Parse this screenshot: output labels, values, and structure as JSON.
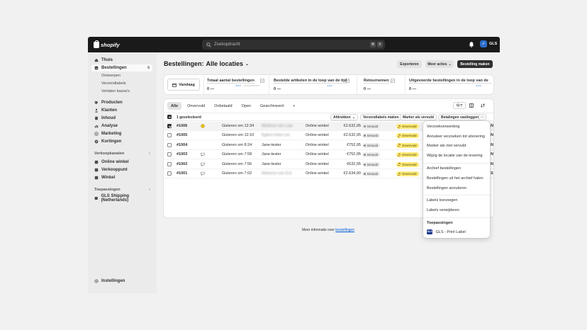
{
  "topbar": {
    "logo_text": "shopify",
    "search_placeholder": "Zoekopdracht",
    "shortcut_1": "⌘",
    "shortcut_2": "K",
    "store_initials": "✓",
    "store_name": "GLS"
  },
  "sidebar": {
    "items": [
      {
        "label": "Thuis",
        "icon": "home-icon"
      },
      {
        "label": "Bestellingen",
        "icon": "inbox-icon",
        "badge": "6"
      },
      {
        "label": "Producten",
        "icon": "tag-icon"
      },
      {
        "label": "Klanten",
        "icon": "person-icon"
      },
      {
        "label": "Inhoud",
        "icon": "document-icon"
      },
      {
        "label": "Analyse",
        "icon": "chart-icon"
      },
      {
        "label": "Marketing",
        "icon": "target-icon"
      },
      {
        "label": "Kortingen",
        "icon": "discount-icon"
      }
    ],
    "sub_items": [
      "Ontwerpen",
      "Verzendlabels",
      "Verlaten kassa's"
    ],
    "sales_channels_label": "Verkoopkanalen",
    "channels": [
      "Online winkel",
      "Verkooppunt",
      "Winkel"
    ],
    "apps_label": "Toepassingen",
    "apps": [
      "GLS Shipping (Netherlands)"
    ],
    "settings_label": "Instellingen"
  },
  "header": {
    "title": "Bestellingen:",
    "location": "Alle locaties",
    "export_label": "Exporteren",
    "more_actions_label": "Meer acties",
    "create_order_label": "Bestelling maken"
  },
  "metrics": {
    "date_label": "Vandaag",
    "items": [
      {
        "label": "Totaal aantal bestellingen",
        "value": "0",
        "dash": "—"
      },
      {
        "label": "Bestelde artikelen in de loop van de tijd",
        "value": "0",
        "dash": "—"
      },
      {
        "label": "Retournemen",
        "value": "0",
        "dash": "—"
      },
      {
        "label": "Uitgevoerde bestellingen in de loop van de",
        "value": "0",
        "dash": "—"
      }
    ]
  },
  "tabs": [
    "Alle",
    "Onvervuld",
    "Onbetaald",
    "Open",
    "Gearchiveerd",
    "+"
  ],
  "bulk": {
    "selected_label": "1 geselecteerd",
    "print_label": "Afdrukken",
    "labels_label": "Verzendlabels maken",
    "fulfill_label": "Marker als vervuld",
    "capture_label": "Betalingen vastleggen",
    "more_label": "···"
  },
  "orders": [
    {
      "id": "#1006",
      "date": "Gisteren om 12:34",
      "customer": "Martinus van Laar",
      "channel": "Online winkel",
      "total": "€2.632,95",
      "payment": "Betaald",
      "fulfillment": "Onvervuld",
      "selected": true,
      "note": "warning"
    },
    {
      "id": "#1005",
      "date": "Gisteren om 12:10",
      "customer": "Egbert Holo Lee",
      "channel": "Online winkel",
      "total": "€2.632,95",
      "payment": "Betaald",
      "fulfillment": "Onvervuld",
      "selected": false,
      "note": ""
    },
    {
      "id": "#1004",
      "date": "Gisteren om 8:24",
      "customer": "Jane-tester",
      "channel": "Online winkel",
      "total": "€752,95",
      "payment": "Betaald",
      "fulfillment": "Onvervuld",
      "selected": false,
      "note": ""
    },
    {
      "id": "#1003",
      "date": "Gisteren om 7:58",
      "customer": "Jane-tester",
      "channel": "Online winkel",
      "total": "€752,95",
      "payment": "Betaald",
      "fulfillment": "Onvervuld",
      "selected": false,
      "note": "comment"
    },
    {
      "id": "#1002",
      "date": "Gisteren om 7:56",
      "customer": "Jane-tester",
      "channel": "Online winkel",
      "total": "€632,95",
      "payment": "Betaald",
      "fulfillment": "Onvervuld",
      "selected": false,
      "note": "comment"
    },
    {
      "id": "#1001",
      "date": "Gisteren om 7:02",
      "customer": "Adrianus van Eck",
      "channel": "Online winkel",
      "total": "€2.634,90",
      "payment": "Betaald",
      "fulfillment": "Onvervuld",
      "selected": false,
      "note": "comment"
    }
  ],
  "trailing_letters": [
    "N",
    "N",
    "N",
    "N",
    "N",
    "S"
  ],
  "footer": {
    "text": "Meer informatie over",
    "link": "bestellingen"
  },
  "menu": {
    "items_group1": [
      "Verzoekverwerking",
      "Annuleer verzoeken tot uitvoering",
      "Marker als niet vervuld",
      "Wijzig de locatie van de levering"
    ],
    "items_group2": [
      "Archief bestellingen",
      "Bestellingen uit het archief halen",
      "Bestellingen annuleren"
    ],
    "items_group3": [
      "Labels toevoegen",
      "Labels verwijderen"
    ],
    "apps_heading": "Toepassingen",
    "app_item": "GLS - Print Label",
    "app_icon_text": "GLS"
  },
  "colors": {
    "topbar": "#1a1a1a",
    "primary_button": "#303030",
    "unfulfilled_badge": "#ffeb78",
    "link": "#005bd3",
    "metric_line": "#7fb5e8"
  }
}
